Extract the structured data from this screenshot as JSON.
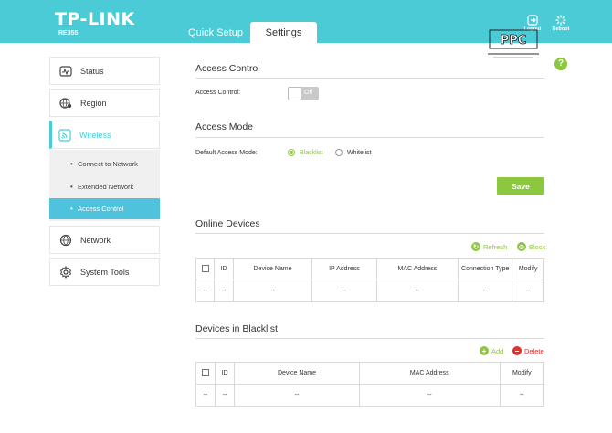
{
  "header": {
    "brand": "TP-LINK",
    "model": "RE355",
    "tabs": [
      {
        "label": "Quick Setup",
        "active": false
      },
      {
        "label": "Settings",
        "active": true
      }
    ],
    "logout_label": "Logout",
    "reboot_label": "Reboot",
    "help_label": "?"
  },
  "watermark": {
    "text": "PurePC"
  },
  "sidebar": {
    "items": [
      {
        "label": "Status",
        "icon": "pulse-icon"
      },
      {
        "label": "Region",
        "icon": "globe-pin-icon"
      },
      {
        "label": "Wireless",
        "icon": "wifi-icon",
        "active": true
      },
      {
        "label": "Network",
        "icon": "globe-icon"
      },
      {
        "label": "System Tools",
        "icon": "gear-icon"
      }
    ],
    "wireless_sub": [
      {
        "label": "Connect to Network"
      },
      {
        "label": "Extended Network"
      },
      {
        "label": "Access Control",
        "active": true
      }
    ]
  },
  "access_control": {
    "title": "Access Control",
    "label": "Access Control:",
    "toggle_value": "Off"
  },
  "access_mode": {
    "title": "Access Mode",
    "label": "Default Access Mode:",
    "options": [
      "Blacklist",
      "Whitelist"
    ],
    "selected": "Blacklist",
    "save_label": "Save"
  },
  "online_devices": {
    "title": "Online Devices",
    "refresh_label": "Refresh",
    "block_label": "Block",
    "columns": [
      "ID",
      "Device Name",
      "IP Address",
      "MAC Address",
      "Connection Type",
      "Modify"
    ],
    "row": [
      "--",
      "--",
      "--",
      "--",
      "--",
      "--",
      "--"
    ]
  },
  "blacklist": {
    "title": "Devices in Blacklist",
    "add_label": "Add",
    "delete_label": "Delete",
    "columns": [
      "ID",
      "Device Name",
      "MAC Address",
      "Modify"
    ],
    "row": [
      "--",
      "--",
      "--",
      "--",
      "--"
    ]
  },
  "colors": {
    "header": "#4acbd6",
    "accent_green": "#8dc63f",
    "delete_red": "#e03030",
    "active_sub": "#4fc3dd"
  }
}
